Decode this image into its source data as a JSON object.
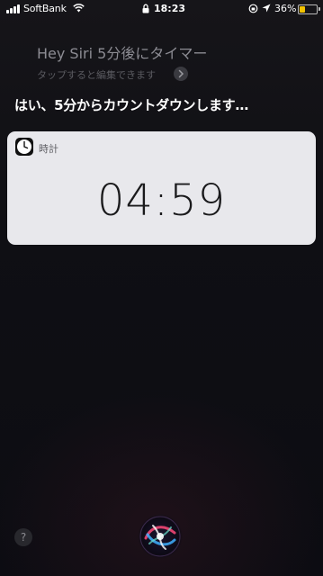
{
  "status_bar": {
    "carrier": "SoftBank",
    "time": "18:23",
    "battery_percent": "36%",
    "battery_level": 0.36,
    "battery_color": "#f2c200"
  },
  "siri": {
    "request": "Hey Siri 5分後にタイマー",
    "edit_hint": "タップすると編集できます",
    "response": "はい、5分からカウントダウンします…"
  },
  "card": {
    "app_name": "時計",
    "app_icon": "clock-icon",
    "timer": "04:59"
  },
  "bottom": {
    "help_label": "?",
    "orb_icon": "siri-orb-icon"
  }
}
